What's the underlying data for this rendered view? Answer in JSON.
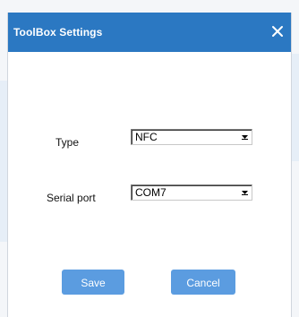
{
  "dialog": {
    "title": "ToolBox Settings"
  },
  "form": {
    "type_label": "Type",
    "type_value": "NFC",
    "serial_label": "Serial port",
    "serial_value": "COM7"
  },
  "buttons": {
    "save_label": "Save",
    "cancel_label": "Cancel"
  },
  "colors": {
    "titlebar": "#2b78c2",
    "button": "#5b9ce0"
  }
}
